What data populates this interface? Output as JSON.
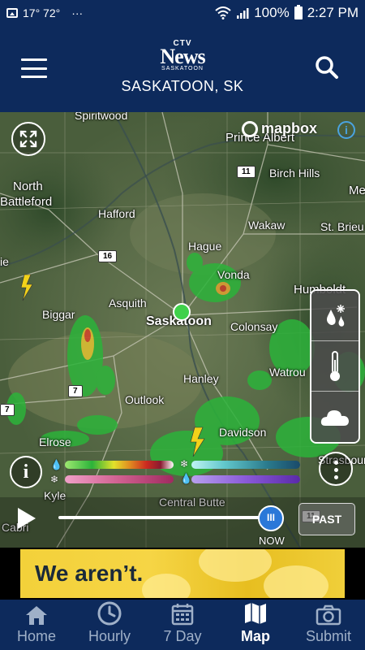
{
  "status_bar": {
    "notification_temps": "17° 72°",
    "dots": "···",
    "battery": "100%",
    "time": "2:27 PM"
  },
  "header": {
    "logo_ctv": "CTV",
    "logo_news": "News",
    "logo_sub": "SASKATOON",
    "city": "SASKATOON, SK"
  },
  "map": {
    "attribution": "mapbox",
    "places": [
      "Spiritwood",
      "Prince Albert",
      "Birch Hills",
      "North",
      "Battleford",
      "Me",
      "Hafford",
      "Wakaw",
      "St. Brieu",
      "Hague",
      "ie",
      "Vonda",
      "Humboldt",
      "Biggar",
      "Asquith",
      "Saskatoon",
      "Colonsay",
      "Watrou",
      "Hanley",
      "Outlook",
      "Davidson",
      "Elrose",
      "Strasbourg",
      "Kyle",
      "Central Butte",
      "Cabri"
    ],
    "highways": [
      "11",
      "16",
      "7",
      "7",
      "11"
    ],
    "info_button": "i"
  },
  "timeline": {
    "knob_label": "III",
    "now_label": "NOW",
    "past_label": "PAST"
  },
  "ad": {
    "text": "We aren’t."
  },
  "nav": {
    "items": [
      {
        "label": "Home",
        "icon": "home-icon"
      },
      {
        "label": "Hourly",
        "icon": "clock-icon"
      },
      {
        "label": "7 Day",
        "icon": "calendar-icon"
      },
      {
        "label": "Map",
        "icon": "map-icon",
        "active": true
      },
      {
        "label": "Submit",
        "icon": "camera-icon"
      }
    ]
  },
  "colors": {
    "header": "#0d2a5c",
    "location_dot": "#3fd14a",
    "timeline_knob": "#2a78d8"
  }
}
